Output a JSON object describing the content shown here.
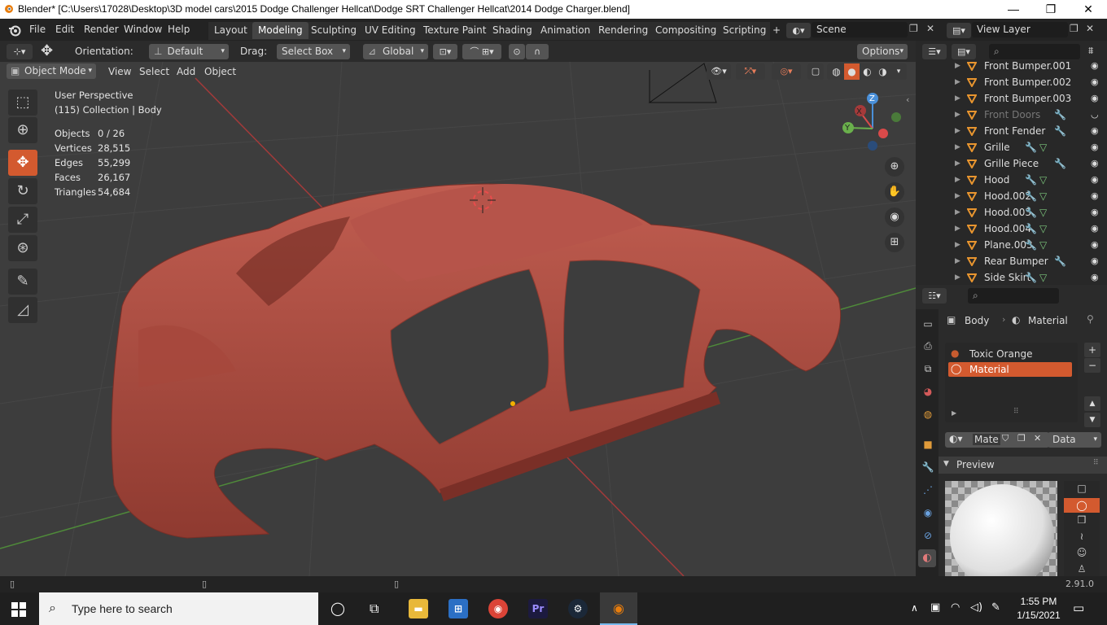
{
  "window": {
    "title": "Blender* [C:\\Users\\17028\\Desktop\\3D model cars\\2015 Dodge Challenger Hellcat\\Dodge SRT Challenger Hellcat\\2014 Dodge Charger.blend]",
    "minimize": "—",
    "maximize": "❐",
    "close": "✕"
  },
  "menubar": {
    "menus": [
      "File",
      "Edit",
      "Render",
      "Window",
      "Help"
    ],
    "workspaces": [
      "Layout",
      "Modeling",
      "Sculpting",
      "UV Editing",
      "Texture Paint",
      "Shading",
      "Animation",
      "Rendering",
      "Compositing",
      "Scripting"
    ],
    "active_workspace": "Modeling",
    "add_tab": "+",
    "scene": "Scene",
    "view_layer": "View Layer"
  },
  "tool_header": {
    "orientation_label": "Orientation:",
    "orientation_value": "Default",
    "drag_label": "Drag:",
    "drag_value": "Select Box",
    "transform_value": "Global",
    "options": "Options"
  },
  "viewport_header": {
    "mode": "Object Mode",
    "menus": [
      "View",
      "Select",
      "Add",
      "Object"
    ]
  },
  "viewport": {
    "perspective": "User Perspective",
    "collection": "(115) Collection | Body",
    "stats": [
      {
        "label": "Objects",
        "value": "0 / 26"
      },
      {
        "label": "Vertices",
        "value": "28,515"
      },
      {
        "label": "Edges",
        "value": "55,299"
      },
      {
        "label": "Faces",
        "value": "26,167"
      },
      {
        "label": "Triangles",
        "value": "54,684"
      }
    ],
    "gizmo": {
      "x": "X",
      "y": "Y",
      "z": "Z"
    }
  },
  "outliner": {
    "items": [
      {
        "name": "Front Bumper.001",
        "muted": false,
        "mod": false,
        "mesh": false
      },
      {
        "name": "Front Bumper.002",
        "muted": false,
        "mod": false,
        "mesh": false
      },
      {
        "name": "Front Bumper.003",
        "muted": false,
        "mod": false,
        "mesh": false
      },
      {
        "name": "Front Doors",
        "muted": true,
        "mod": true,
        "mesh": false
      },
      {
        "name": "Front Fender",
        "muted": false,
        "mod": true,
        "mesh": false
      },
      {
        "name": "Grille",
        "muted": false,
        "mod": true,
        "mesh": true
      },
      {
        "name": "Grille Piece",
        "muted": false,
        "mod": true,
        "mesh": false
      },
      {
        "name": "Hood",
        "muted": false,
        "mod": true,
        "mesh": true
      },
      {
        "name": "Hood.002",
        "muted": false,
        "mod": true,
        "mesh": true
      },
      {
        "name": "Hood.003",
        "muted": false,
        "mod": true,
        "mesh": true
      },
      {
        "name": "Hood.004",
        "muted": false,
        "mod": true,
        "mesh": true
      },
      {
        "name": "Plane.003",
        "muted": false,
        "mod": true,
        "mesh": true
      },
      {
        "name": "Rear Bumper",
        "muted": false,
        "mod": true,
        "mesh": false
      },
      {
        "name": "Side Skirt",
        "muted": false,
        "mod": true,
        "mesh": true
      }
    ]
  },
  "properties": {
    "breadcrumb_object": "Body",
    "breadcrumb_section": "Material",
    "material_slots": [
      "Toxic Orange",
      "Material"
    ],
    "selected_slot": 1,
    "material_name": "Mate",
    "link": "Data",
    "preview_label": "Preview"
  },
  "status": {
    "version": "2.91.0"
  },
  "taskbar": {
    "search_placeholder": "Type here to search",
    "time": "1:55 PM",
    "date": "1/15/2021"
  },
  "colors": {
    "accent": "#d35a2f",
    "car_body": "#b0483d",
    "viewport_bg": "#3d3d3d"
  }
}
